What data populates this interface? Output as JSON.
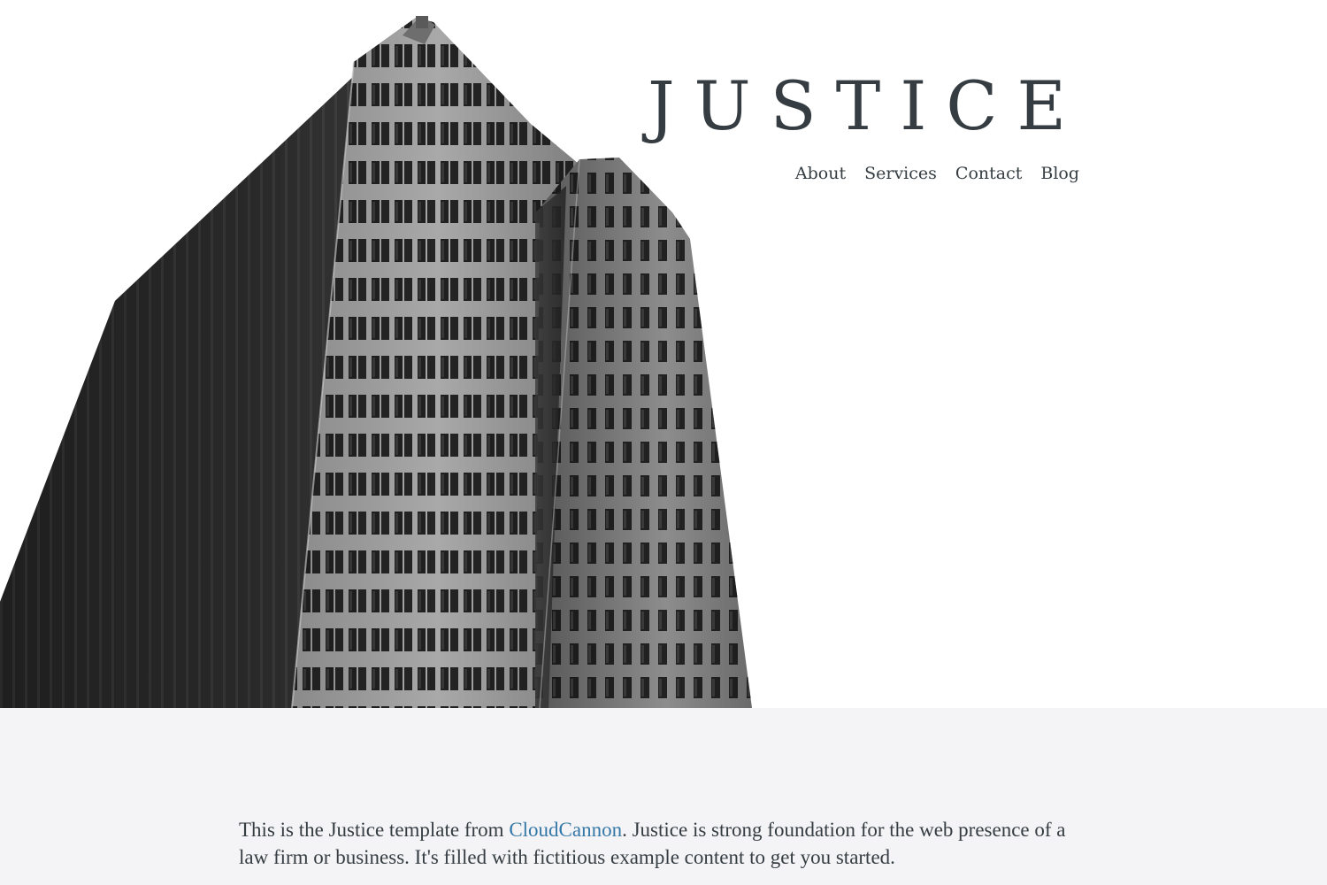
{
  "header": {
    "brand": "JUSTICE",
    "nav": [
      {
        "label": "About"
      },
      {
        "label": "Services"
      },
      {
        "label": "Contact"
      },
      {
        "label": "Blog"
      }
    ]
  },
  "hero": {
    "image": "building-photo"
  },
  "intro": {
    "text_before": "This is the Justice template from ",
    "link_label": "CloudCannon",
    "text_after": ". Justice is strong foundation for the web presence of a law firm or business. It's filled with fictitious example content to get you started."
  },
  "colors": {
    "text": "#353d42",
    "link": "#3478a7",
    "section_bg": "#f4f4f6"
  }
}
